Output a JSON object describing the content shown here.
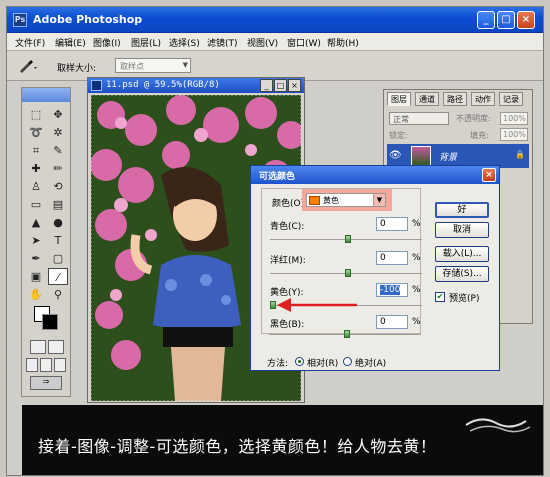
{
  "window": {
    "title": "Adobe Photoshop",
    "icon": "photoshop-icon",
    "min_label": "_",
    "max_label": "□",
    "close_label": "×"
  },
  "menu": [
    "文件(F)",
    "编辑(E)",
    "图像(I)",
    "图层(L)",
    "选择(S)",
    "滤镜(T)",
    "视图(V)",
    "窗口(W)",
    "帮助(H)"
  ],
  "options": {
    "tool_icon": "eyedropper-icon",
    "sample_label": "取样大小:",
    "sample_value": "取样点"
  },
  "document": {
    "title": "11.psd @ 59.5%(RGB/8)"
  },
  "layers": {
    "tabs": [
      "图层",
      "通道",
      "路径",
      "动作",
      "记录"
    ],
    "blend_mode": "正常",
    "opacity_label": "不透明度:",
    "opacity_value": "100%",
    "lock_label": "锁定:",
    "fill_label": "填充:",
    "fill_value": "100%",
    "layer_name": "背景"
  },
  "dialog": {
    "title": "可选颜色",
    "colors_label": "颜色(O):",
    "colors_value": "黄色",
    "colors_swatch": "#ff7f00",
    "sliders": [
      {
        "label": "青色(C):",
        "value": "0",
        "unit": "%"
      },
      {
        "label": "洋红(M):",
        "value": "0",
        "unit": "%"
      },
      {
        "label": "黄色(Y):",
        "value": "-100",
        "unit": "%"
      },
      {
        "label": "黑色(B):",
        "value": "0",
        "unit": "%"
      }
    ],
    "buttons": {
      "ok": "好",
      "cancel": "取消",
      "load": "载入(L)...",
      "save": "存储(S)..."
    },
    "preview_label": "预览(P)",
    "preview_checked": true,
    "method_label": "方法:",
    "method_relative": "相对(R)",
    "method_absolute": "绝对(A)"
  },
  "caption": "接着-图像-调整-可选颜色，选择黄颜色！给人物去黄！",
  "colors": {
    "titlebar": "#0a4dd0",
    "highlight": "#f4a79a",
    "arrow": "#e02020"
  }
}
